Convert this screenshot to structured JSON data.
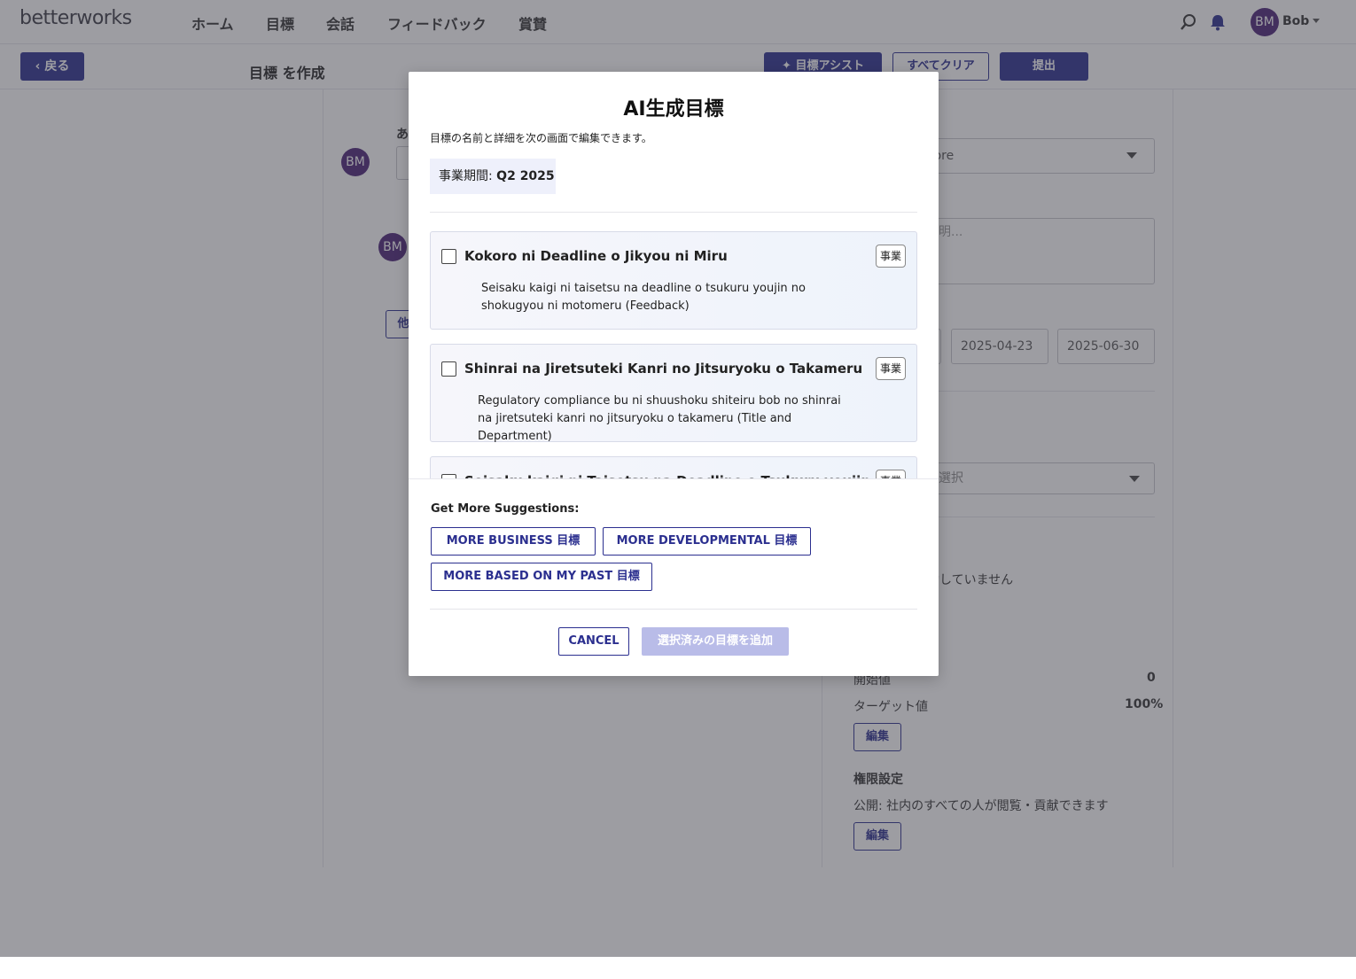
{
  "app": {
    "logo": "betterworks"
  },
  "nav": {
    "items": [
      "ホーム",
      "目標",
      "会話",
      "フィードバック",
      "賞賛"
    ],
    "user_initials": "BM",
    "user_name": "Bob"
  },
  "subheader": {
    "back_label": "戻る",
    "title": "目標 を作成",
    "assist_label": "目標アシスト",
    "clear_label": "すべてクリア",
    "submit_label": "提出"
  },
  "background_form": {
    "owner_initials": "BM",
    "owner_label_fragment": "あ",
    "other_btn_fragment": "他",
    "owner_select_fragment": "oore",
    "description_placeholder_fragment": "説明...",
    "start_date": "2025-04-23",
    "end_date": "2025-06-30",
    "select_placeholder_fragment": "を選択",
    "status_fragment": "動していません",
    "start_value_label": "開始値",
    "start_value": "0",
    "target_value_label": "ターゲット値",
    "target_value": "100%",
    "edit_label": "編集",
    "permission_heading": "権限設定",
    "permission_text": "公開: 社内のすべての人が閲覧・貢献できます"
  },
  "modal": {
    "title": "AI生成目標",
    "subtitle": "目標の名前と詳細を次の画面で編集できます。",
    "period_label": "事業期間: ",
    "period_value": "Q2 2025",
    "goals": [
      {
        "title": "Kokoro ni Deadline o Jikyou ni Miru",
        "tag": "事業",
        "description": "Seisaku kaigi ni taisetsu na deadline o tsukuru youjin no shokugyou ni motomeru (Feedback)",
        "checked": false
      },
      {
        "title": "Shinrai na Jiretsuteki Kanri no Jitsuryoku o Takameru",
        "tag": "事業",
        "description": "Regulatory compliance bu ni shuushoku shiteiru bob no shinrai na jiretsuteki kanri no jitsuryoku o takameru (Title and Department)",
        "checked": false
      },
      {
        "title": "Seisaku kaigi ni Taisetsu na Deadline o Tsukuru youjin no",
        "tag": "事業",
        "description": "",
        "checked": false
      }
    ],
    "more_label": "Get More Suggestions:",
    "more_buttons": [
      "MORE BUSINESS 目標",
      "MORE DEVELOPMENTAL 目標",
      "MORE BASED ON MY PAST 目標"
    ],
    "cancel_label": "CANCEL",
    "add_label": "選択済みの目標を追加"
  },
  "colors": {
    "brand": "#2b2f8f",
    "avatar": "#4a2377",
    "disabled_button": "#b9bce8"
  }
}
